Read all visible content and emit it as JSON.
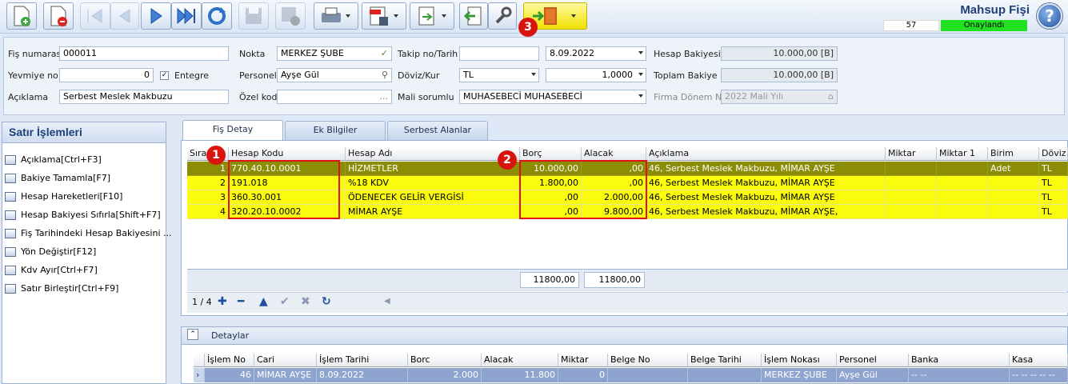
{
  "document": {
    "title": "Mahsup Fişi",
    "number": "57",
    "status": "Onaylandı",
    "status_color": "#22e022"
  },
  "toolbar": {
    "buttons": [
      {
        "name": "new-icon"
      },
      {
        "name": "delete-icon"
      },
      {
        "name": "first-icon"
      },
      {
        "name": "prev-icon"
      },
      {
        "name": "next-icon"
      },
      {
        "name": "last-icon"
      },
      {
        "name": "refresh-icon"
      },
      {
        "name": "save-icon"
      },
      {
        "name": "save-close-icon"
      },
      {
        "name": "print-icon"
      },
      {
        "name": "pdf-icon"
      },
      {
        "name": "export-icon"
      },
      {
        "name": "back-icon"
      },
      {
        "name": "tools-icon"
      },
      {
        "name": "exit-icon"
      }
    ],
    "callout_3": "3"
  },
  "form": {
    "fis_numarasi_label": "Fiş numarası",
    "fis_numarasi": "000011",
    "yevmiye_label": "Yevmiye no",
    "yevmiye": "0",
    "entegre_label": "Entegre",
    "aciklama_label": "Açıklama",
    "aciklama": "Serbest Meslek Makbuzu",
    "nokta_label": "Nokta",
    "nokta": "MERKEZ ŞUBE",
    "personel_label": "Personel",
    "personel": "Ayşe Gül",
    "ozel_kod_label": "Özel kod",
    "ozel_kod": "...",
    "takip_label": "Takip no/Tarih",
    "takip": "",
    "tarih": "8.09.2022",
    "doviz_label": "Döviz/Kur",
    "doviz": "TL",
    "kur": "1,0000",
    "mali_label": "Mali sorumlu",
    "mali": "MUHASEBECİ MUHASEBECİ",
    "hesap_bakiyesi_label": "Hesap Bakiyesi",
    "hesap_bakiyesi": "10.000,00 [B]",
    "toplam_bakiye_label": "Toplam Bakiye",
    "toplam_bakiye": "10.000,00 [B]",
    "firma_donem_label": "Firma Dönem No",
    "firma_donem": "2022 Mali Yılı"
  },
  "left_panel": {
    "title": "Satır İşlemleri",
    "items": [
      {
        "label": "Açıklama[Ctrl+F3]"
      },
      {
        "label": "Bakiye Tamamla[F7]"
      },
      {
        "label": "Hesap Hareketleri[F10]"
      },
      {
        "label": "Hesap Bakiyesi Sıfırla[Shift+F7]"
      },
      {
        "label": "Fiş Tarihindeki Hesap Bakiyesini ..."
      },
      {
        "label": "Yön Değiştir[F12]"
      },
      {
        "label": "Kdv Ayır[Ctrl+F7]"
      },
      {
        "label": "Satır Birleştir[Ctrl+F9]"
      }
    ]
  },
  "tabs": [
    {
      "label": "Fiş Detay"
    },
    {
      "label": "Ek Bilgiler"
    },
    {
      "label": "Serbest Alanlar"
    }
  ],
  "grid": {
    "columns": [
      "Sıra",
      "Hesap Kodu",
      "Hesap Adı",
      "Borç",
      "Alacak",
      "Açıklama",
      "Miktar",
      "Miktar 1",
      "Birim",
      "Döviz"
    ],
    "rows": [
      {
        "sira": "1",
        "kod": "770.40.10.0001",
        "ad": "HİZMETLER",
        "borc": "10.000,00",
        "alacak": ",00",
        "aciklama": "46, Serbest Meslek Makbuzu, MİMAR AYŞE",
        "birim": "Adet",
        "doviz": "TL"
      },
      {
        "sira": "2",
        "kod": "191.018",
        "ad": "%18 KDV",
        "borc": "1.800,00",
        "alacak": ",00",
        "aciklama": "46, Serbest Meslek Makbuzu, MİMAR AYŞE",
        "birim": "",
        "doviz": "TL"
      },
      {
        "sira": "3",
        "kod": "360.30.001",
        "ad": "ÖDENECEK GELİR VERGİSİ",
        "borc": ",00",
        "alacak": "2.000,00",
        "aciklama": "46, Serbest Meslek Makbuzu, MİMAR AYŞE",
        "birim": "",
        "doviz": "TL"
      },
      {
        "sira": "4",
        "kod": "320.20.10.0002",
        "ad": "MİMAR AYŞE",
        "borc": ",00",
        "alacak": "9.800,00",
        "aciklama": "46, Serbest Meslek Makbuzu, MİMAR AYŞE,",
        "birim": "",
        "doviz": "TL"
      }
    ],
    "total_borc": "11800,00",
    "total_alacak": "11800,00",
    "pager": "1 / 4",
    "callout_1": "1",
    "callout_2": "2"
  },
  "detail": {
    "title": "Detaylar",
    "columns": [
      "İşlem No",
      "Cari",
      "İşlem Tarihi",
      "Borc",
      "Alacak",
      "Miktar",
      "Belge No",
      "Belge Tarihi",
      "İşlem Nokası",
      "Personel",
      "Banka",
      "Kasa"
    ],
    "row": {
      "islem_no": "46",
      "cari": "MİMAR AYŞE",
      "tarih": "8.09.2022",
      "borc": "2.000",
      "alacak": "11.800",
      "miktar": "0",
      "belge_no": "",
      "belge_tarihi": "",
      "nokta": "MERKEZ ŞUBE",
      "personel": "Ayşe Gül",
      "banka": "-- --",
      "kasa": "-- -- -- -- --"
    }
  }
}
